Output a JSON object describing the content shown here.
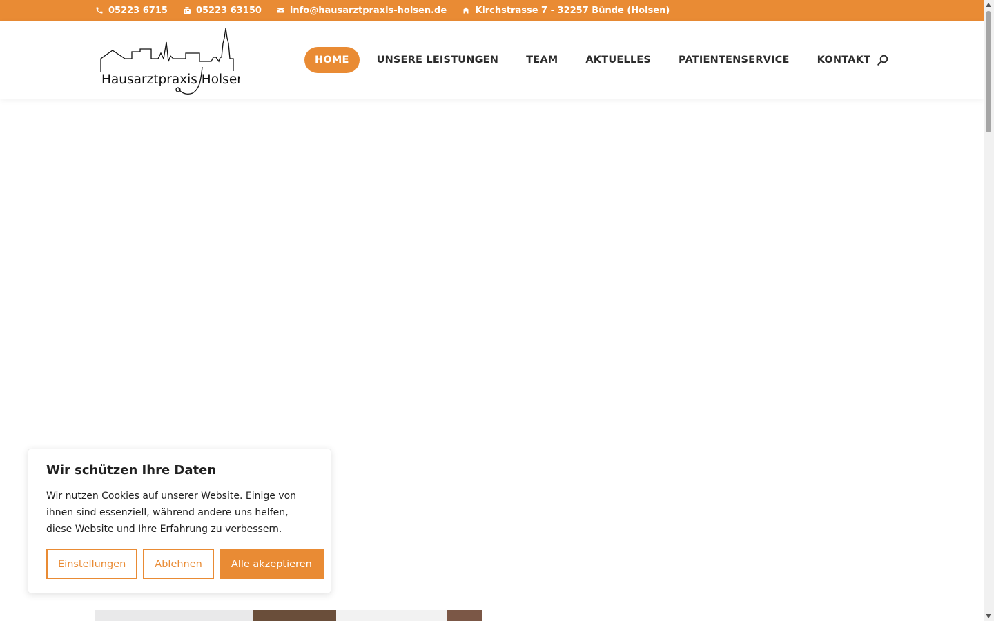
{
  "topbar": {
    "phone": "05223 6715",
    "fax": "05223 63150",
    "email": "info@hausarztpraxis-holsen.de",
    "address": "Kirchstrasse 7 - 32257 Bünde (Holsen)"
  },
  "logo": {
    "text": "Hausarztpraxis Holsen"
  },
  "nav": {
    "items": [
      {
        "label": "HOME"
      },
      {
        "label": "UNSERE LEISTUNGEN"
      },
      {
        "label": "TEAM"
      },
      {
        "label": "AKTUELLES"
      },
      {
        "label": "PATIENTENSERVICE"
      },
      {
        "label": "KONTAKT"
      }
    ],
    "active_index": 0
  },
  "cookie": {
    "title": "Wir schützen Ihre Daten",
    "text": "Wir nutzen Cookies auf unserer Website. Einige von ihnen sind essenziell, während andere uns helfen, diese Website und Ihre Erfahrung zu verbessern.",
    "settings_label": "Einstellungen",
    "reject_label": "Ablehnen",
    "accept_label": "Alle akzeptieren"
  },
  "icons": {
    "phone": "phone-icon",
    "fax": "fax-icon",
    "email": "email-icon",
    "address": "home-icon",
    "search": "search-icon"
  },
  "colors": {
    "accent": "#e98b34",
    "text": "#2c2c2c",
    "white": "#ffffff"
  }
}
